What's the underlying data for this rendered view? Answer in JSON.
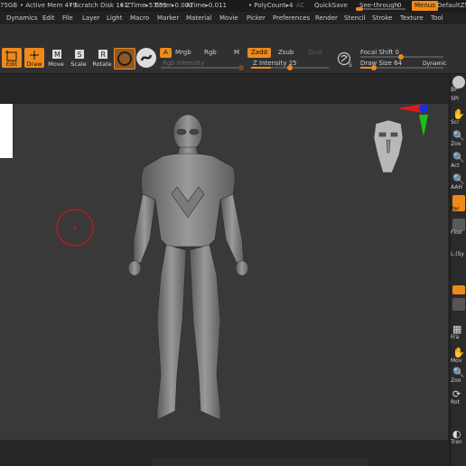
{
  "status": {
    "mem": "75GB",
    "active_mem": "• Active Mem 479",
    "scratch": "• Scratch Disk 161",
    "ztime": "• ZTime▸5.655",
    "timer": "Timer▸0.003",
    "atime": "ATime▸0.011",
    "polycount": "• PolyCount▸4",
    "ac": "AC",
    "quicksave": "QuickSave",
    "see_through_label": "See-through",
    "see_through_value": "0",
    "menus_button": "Menus",
    "script": "DefaultZSc"
  },
  "menus": [
    "Dynamics",
    "Edit",
    "File",
    "Layer",
    "Light",
    "Macro",
    "Marker",
    "Material",
    "Movie",
    "Picker",
    "Preferences",
    "Render",
    "Stencil",
    "Stroke",
    "Texture",
    "Tool"
  ],
  "toolbar": {
    "edit": "Edit",
    "draw": "Draw",
    "move": "Move",
    "scale": "Scale",
    "rotate": "Rotate",
    "a_button": "A",
    "mrgb": "Mrgb",
    "rgb": "Rgb",
    "m": "M",
    "zadd": "Zadd",
    "zsub": "Zsub",
    "zcut": "Zcut",
    "rgb_intensity": "Rgb Intensity",
    "z_intensity": "Z Intensity 25",
    "focal_shift": "Focal Shift 0",
    "draw_size": "Draw Size 64",
    "dynamic": "Dynamic",
    "s": "S"
  },
  "shelf": {
    "items": [
      "BP",
      "SPi",
      "Scr",
      "Zoo",
      "Act",
      "AAH",
      "Per",
      "Floo",
      "L.Sy",
      "Fra",
      "Mov",
      "Zoo",
      "Rot",
      "Tran"
    ],
    "lsym": "L.(Sy"
  },
  "colors": {
    "accent": "#ee8a1c",
    "axis_red": "#e01a1a",
    "axis_green": "#18c21a",
    "axis_blue": "#1a2fe0",
    "cursor_red": "#c0191f"
  }
}
